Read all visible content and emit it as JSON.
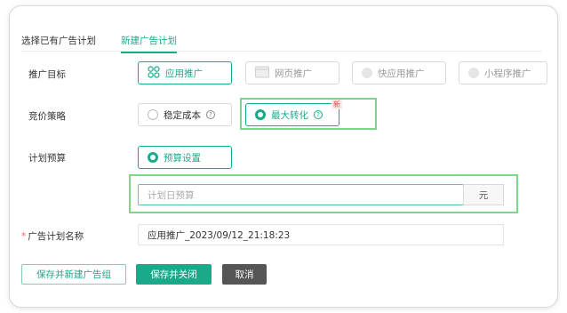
{
  "tabs": [
    {
      "label": "选择已有广告计划"
    },
    {
      "label": "新建广告计划"
    }
  ],
  "promo_target": {
    "label": "推广目标",
    "options": [
      {
        "label": "应用推广",
        "icon": "grid-icon"
      },
      {
        "label": "网页推广",
        "icon": "webpage-icon"
      },
      {
        "label": "快应用推广",
        "icon": "circle-icon"
      },
      {
        "label": "小程序推广",
        "icon": "circle-icon"
      }
    ]
  },
  "bid_strategy": {
    "label": "竞价策略",
    "options": [
      {
        "label": "稳定成本"
      },
      {
        "label": "最大转化"
      }
    ],
    "new_badge": "新",
    "help_glyph": "?"
  },
  "budget": {
    "label": "计划预算",
    "option": "预算设置",
    "placeholder": "计划日预算",
    "unit": "元"
  },
  "plan_name": {
    "required_mark": "*",
    "label": "广告计划名称",
    "value": "应用推广_2023/09/12_21:18:23"
  },
  "actions": {
    "save_new_group": "保存并新建广告组",
    "save_close": "保存并关闭",
    "cancel": "取消"
  },
  "colors": {
    "accent": "#1aaa8a",
    "highlight": "#7bd88a",
    "badge": "#e64545"
  }
}
